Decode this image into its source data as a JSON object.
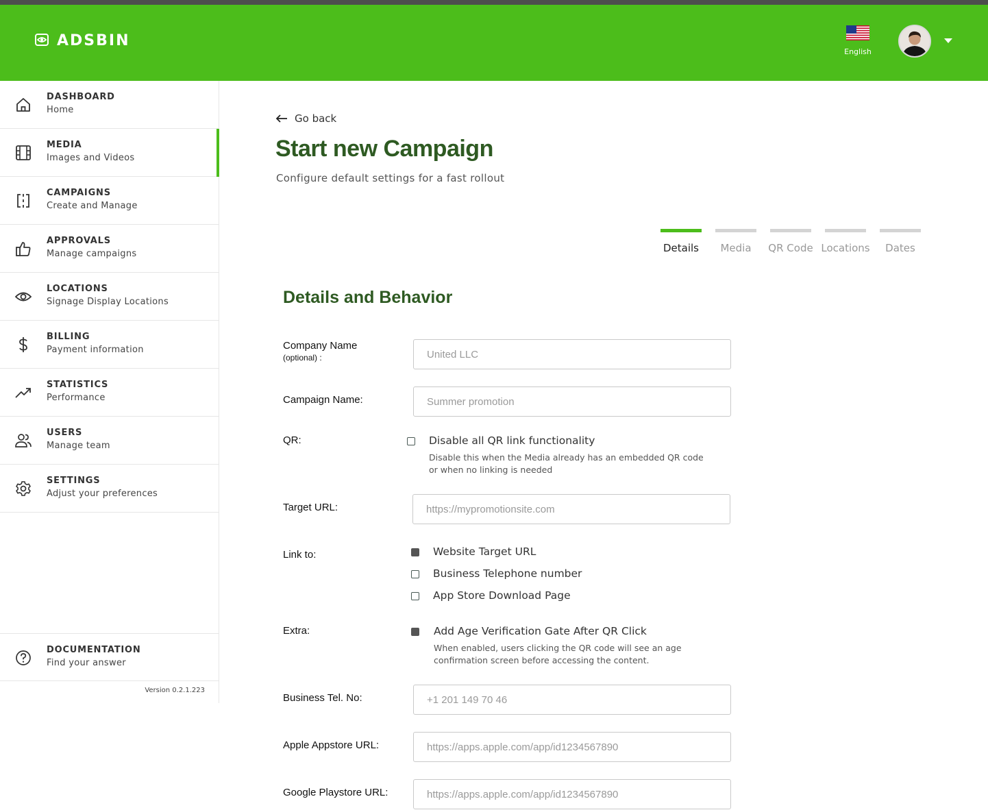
{
  "brand": {
    "name": "ADSBIN"
  },
  "header": {
    "language": "English"
  },
  "sidebar": {
    "items": [
      {
        "title": "DASHBOARD",
        "sub": "Home",
        "icon": "home-icon"
      },
      {
        "title": "MEDIA",
        "sub": "Images and Videos",
        "icon": "film-icon",
        "active": true
      },
      {
        "title": "CAMPAIGNS",
        "sub": "Create and Manage",
        "icon": "campaign-icon"
      },
      {
        "title": "APPROVALS",
        "sub": "Manage campaigns",
        "icon": "thumbs-up-icon"
      },
      {
        "title": "LOCATIONS",
        "sub": "Signage Display Locations",
        "icon": "eye-icon"
      },
      {
        "title": "BILLING",
        "sub": "Payment information",
        "icon": "dollar-icon"
      },
      {
        "title": "STATISTICS",
        "sub": "Performance",
        "icon": "trending-up-icon"
      },
      {
        "title": "USERS",
        "sub": "Manage team",
        "icon": "users-icon"
      },
      {
        "title": "SETTINGS",
        "sub": "Adjust your preferences",
        "icon": "gear-icon"
      }
    ],
    "documentation": {
      "title": "DOCUMENTATION",
      "sub": "Find your answer",
      "icon": "help-circle-icon"
    },
    "version": "Version 0.2.1.223"
  },
  "page": {
    "go_back": "Go back",
    "title": "Start new Campaign",
    "subtitle": "Configure default settings for a fast rollout"
  },
  "steps": [
    {
      "label": "Details",
      "active": true
    },
    {
      "label": "Media"
    },
    {
      "label": "QR Code"
    },
    {
      "label": "Locations"
    },
    {
      "label": "Dates"
    }
  ],
  "form": {
    "section_title": "Details and Behavior",
    "company_name": {
      "label": "Company Name",
      "optional": "(optional) :",
      "placeholder": "United LLC"
    },
    "campaign_name": {
      "label": "Campaign Name:",
      "placeholder": "Summer promotion"
    },
    "qr": {
      "label": "QR:",
      "option": "Disable all QR link functionality",
      "help": "Disable this when the Media already has an embedded QR code or when no linking is needed",
      "checked": false
    },
    "target_url": {
      "label": "Target URL:",
      "placeholder": "https://mypromotionsite.com"
    },
    "link_to": {
      "label": "Link to:",
      "options": [
        {
          "label": "Website Target URL",
          "selected": true
        },
        {
          "label": "Business Telephone number",
          "selected": false
        },
        {
          "label": "App Store Download Page",
          "selected": false
        }
      ]
    },
    "extra": {
      "label": "Extra:",
      "option": "Add Age Verification Gate After QR Click",
      "help": "When enabled, users clicking the QR code will see an age confirmation screen before accessing the content.",
      "checked": true
    },
    "business_tel": {
      "label": "Business Tel. No:",
      "placeholder": "+1 201 149 70 46"
    },
    "apple_url": {
      "label": "Apple Appstore URL:",
      "placeholder": "https://apps.apple.com/app/id1234567890"
    },
    "google_url": {
      "label": "Google Playstore URL:",
      "placeholder": "https://apps.apple.com/app/id1234567890"
    }
  }
}
